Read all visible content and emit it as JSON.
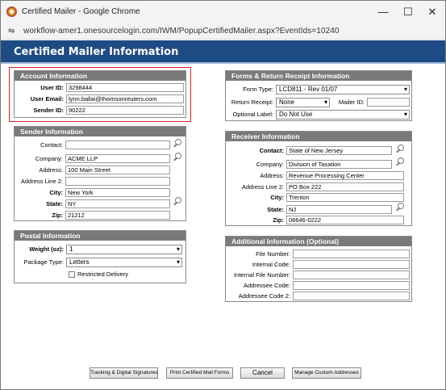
{
  "window": {
    "title": "Certified Mailer - Google Chrome",
    "url": "workflow-amer1.onesourcelogin.com/IWM/PopupCertifiedMailer.aspx?EventIds=10240",
    "minimize": "—",
    "maximize": "☐",
    "close": "✕",
    "url_icon": "⇋"
  },
  "page_title": "Certified Mailer Information",
  "account": {
    "heading": "Account Information",
    "user_id_label": "User ID:",
    "user_id": "3298444",
    "user_email_label": "User Email:",
    "user_email": "lynn.ballai@thomsonreuters.com",
    "sender_id_label": "Sender ID:",
    "sender_id": "90222"
  },
  "sender": {
    "heading": "Sender Information",
    "contact_label": "Contact:",
    "contact": "",
    "company_label": "Company:",
    "company": "ACME LLP",
    "address_label": "Address:",
    "address": "100 Main Street",
    "address2_label": "Address Line 2:",
    "address2": "",
    "city_label": "City:",
    "city": "New York",
    "state_label": "State:",
    "state": "NY",
    "zip_label": "Zip:",
    "zip": "21212"
  },
  "postal": {
    "heading": "Postal Information",
    "weight_label": "Weight (oz):",
    "weight": "1",
    "package_label": "Package Type:",
    "package": "Letters",
    "restricted_label": "Restricted Delivery",
    "restricted_checked": false
  },
  "forms": {
    "heading": "Forms & Return Receipt Information",
    "form_type_label": "Form Type:",
    "form_type": "LCD811 - Rev 01/07",
    "return_receipt_label": "Return Receipt:",
    "return_receipt": "None",
    "mailer_id_label": "Mailer ID:",
    "mailer_id": "",
    "optional_label_label": "Optional Label:",
    "optional_label": "Do Not Use"
  },
  "receiver": {
    "heading": "Receiver Information",
    "contact_label": "Contact:",
    "contact": "State of New Jersey",
    "company_label": "Company:",
    "company": "Division of Taxation",
    "address_label": "Address:",
    "address": "Revenue Processing Center",
    "address2_label": "Address Line 2:",
    "address2": "PO Box 222",
    "city_label": "City:",
    "city": "Trenton",
    "state_label": "State:",
    "state": "NJ",
    "zip_label": "Zip:",
    "zip": "08646-0222"
  },
  "additional": {
    "heading": "Additional Information (Optional)",
    "file_number_label": "File Number:",
    "internal_code_label": "Internal Code:",
    "internal_file_number_label": "Internal File Number:",
    "addressee_code_label": "Addressee Code:",
    "addressee_code2_label": "Addressee Code 2:"
  },
  "buttons": {
    "tracking": "Tracking & Digital Signatures",
    "print": "Print Certified Mail Forms",
    "cancel": "Cancel",
    "manage": "Manage Custom Addresses"
  },
  "colors": {
    "header_blue": "#1f4b84",
    "panel_gray": "#7a7a7a",
    "highlight_red": "#d7262a"
  }
}
